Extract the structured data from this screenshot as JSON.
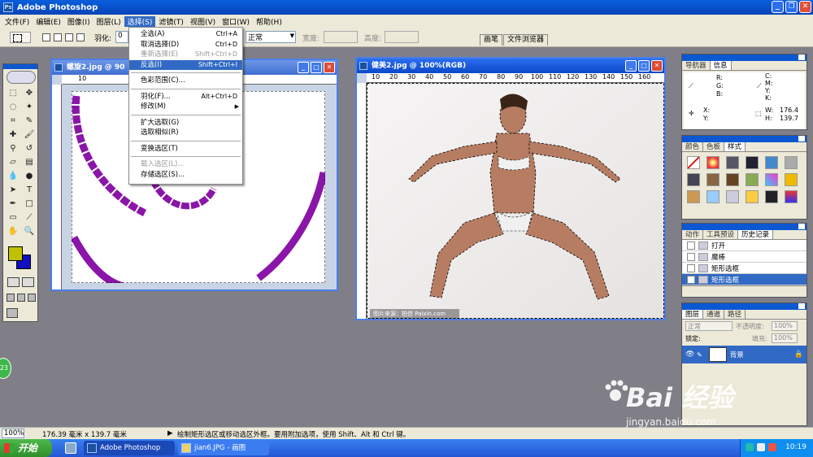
{
  "app": {
    "title": "Adobe Photoshop",
    "logo_text": "Ps"
  },
  "menubar": {
    "items": [
      "文件(F)",
      "编辑(E)",
      "图像(I)",
      "图层(L)",
      "选择(S)",
      "滤镜(T)",
      "视图(V)",
      "窗口(W)",
      "帮助(H)"
    ],
    "active_index": 4
  },
  "options": {
    "feather_label": "羽化:",
    "feather_value": "0",
    "style_value": "正常",
    "width_label": "宽度:",
    "height_label": "高度:"
  },
  "palette_well": [
    "画笔",
    "文件浏览器"
  ],
  "select_menu": {
    "items": [
      {
        "label": "全选(A)",
        "shortcut": "Ctrl+A",
        "enabled": true
      },
      {
        "label": "取消选择(D)",
        "shortcut": "Ctrl+D",
        "enabled": true
      },
      {
        "label": "重新选择(E)",
        "shortcut": "Shift+Ctrl+D",
        "enabled": false
      },
      {
        "label": "反选(I)",
        "shortcut": "Shift+Ctrl+I",
        "enabled": true,
        "highlighted": true
      },
      {
        "separator": true
      },
      {
        "label": "色彩范围(C)...",
        "shortcut": "",
        "enabled": true
      },
      {
        "separator": true
      },
      {
        "label": "羽化(F)...",
        "shortcut": "Alt+Ctrl+D",
        "enabled": true
      },
      {
        "label": "修改(M)",
        "shortcut": "",
        "enabled": true,
        "submenu": true
      },
      {
        "separator": true
      },
      {
        "label": "扩大选取(G)",
        "shortcut": "",
        "enabled": true
      },
      {
        "label": "选取相似(R)",
        "shortcut": "",
        "enabled": true
      },
      {
        "separator": true
      },
      {
        "label": "变换选区(T)",
        "shortcut": "",
        "enabled": true
      },
      {
        "separator": true
      },
      {
        "label": "载入选区(L)...",
        "shortcut": "",
        "enabled": false
      },
      {
        "label": "存储选区(S)...",
        "shortcut": "",
        "enabled": true
      }
    ]
  },
  "doc_left": {
    "title": "螺旋2.jpg @ 90",
    "ruler_marks": [
      "10",
      "20",
      "30"
    ],
    "spiral_color": "#8a15a8"
  },
  "doc_right": {
    "title": "健美2.jpg @ 100%(RGB)",
    "ruler_marks": [
      "10",
      "20",
      "30",
      "40",
      "50",
      "60",
      "70",
      "80",
      "90",
      "100",
      "110",
      "120",
      "130",
      "140",
      "150",
      "160"
    ],
    "caption": "图片来源：拍信 Paixin.com"
  },
  "info_panel": {
    "tabs": [
      "导航器",
      "信息"
    ],
    "active_tab": 1,
    "labels": {
      "r": "R:",
      "g": "G:",
      "b": "B:",
      "c": "C:",
      "m": "M:",
      "y": "Y:",
      "k": "K:",
      "x": "X:",
      "yy": "Y:",
      "w": "W:",
      "h": "H:"
    },
    "w_value": "176.4",
    "h_value": "139.7"
  },
  "swatch_panel": {
    "tabs": [
      "颜色",
      "色板",
      "样式"
    ],
    "active_tab": 2
  },
  "history_panel": {
    "tabs": [
      "动作",
      "工具预设",
      "历史记录"
    ],
    "active_tab": 2,
    "items": [
      {
        "label": "打开",
        "selected": false
      },
      {
        "label": "魔棒",
        "selected": false
      },
      {
        "label": "矩形选框",
        "selected": false
      },
      {
        "label": "矩形选框",
        "selected": true
      }
    ]
  },
  "layers_panel": {
    "tabs": [
      "图层",
      "通道",
      "路径"
    ],
    "active_tab": 0,
    "blend_mode": "正常",
    "opacity_label": "不透明度:",
    "opacity_value": "100%",
    "lock_label": "锁定:",
    "fill_label": "填充:",
    "fill_value": "100%",
    "layer_name": "背景"
  },
  "statusbar": {
    "zoom": "100%",
    "doc_size": "176.39 毫米 x 139.7 毫米",
    "hint": "绘制矩形选区或移动选区外框。要用附加选项，使用 Shift、Alt 和 Ctrl 键。"
  },
  "taskbar": {
    "start_label": "开始",
    "tasks": [
      "Adobe Photoshop",
      "jian6.JPG - 画图"
    ],
    "clock": "10:19"
  },
  "watermark": {
    "brand": "Bai 经验",
    "url": "jingyan.baidu.com"
  },
  "badge": "23"
}
